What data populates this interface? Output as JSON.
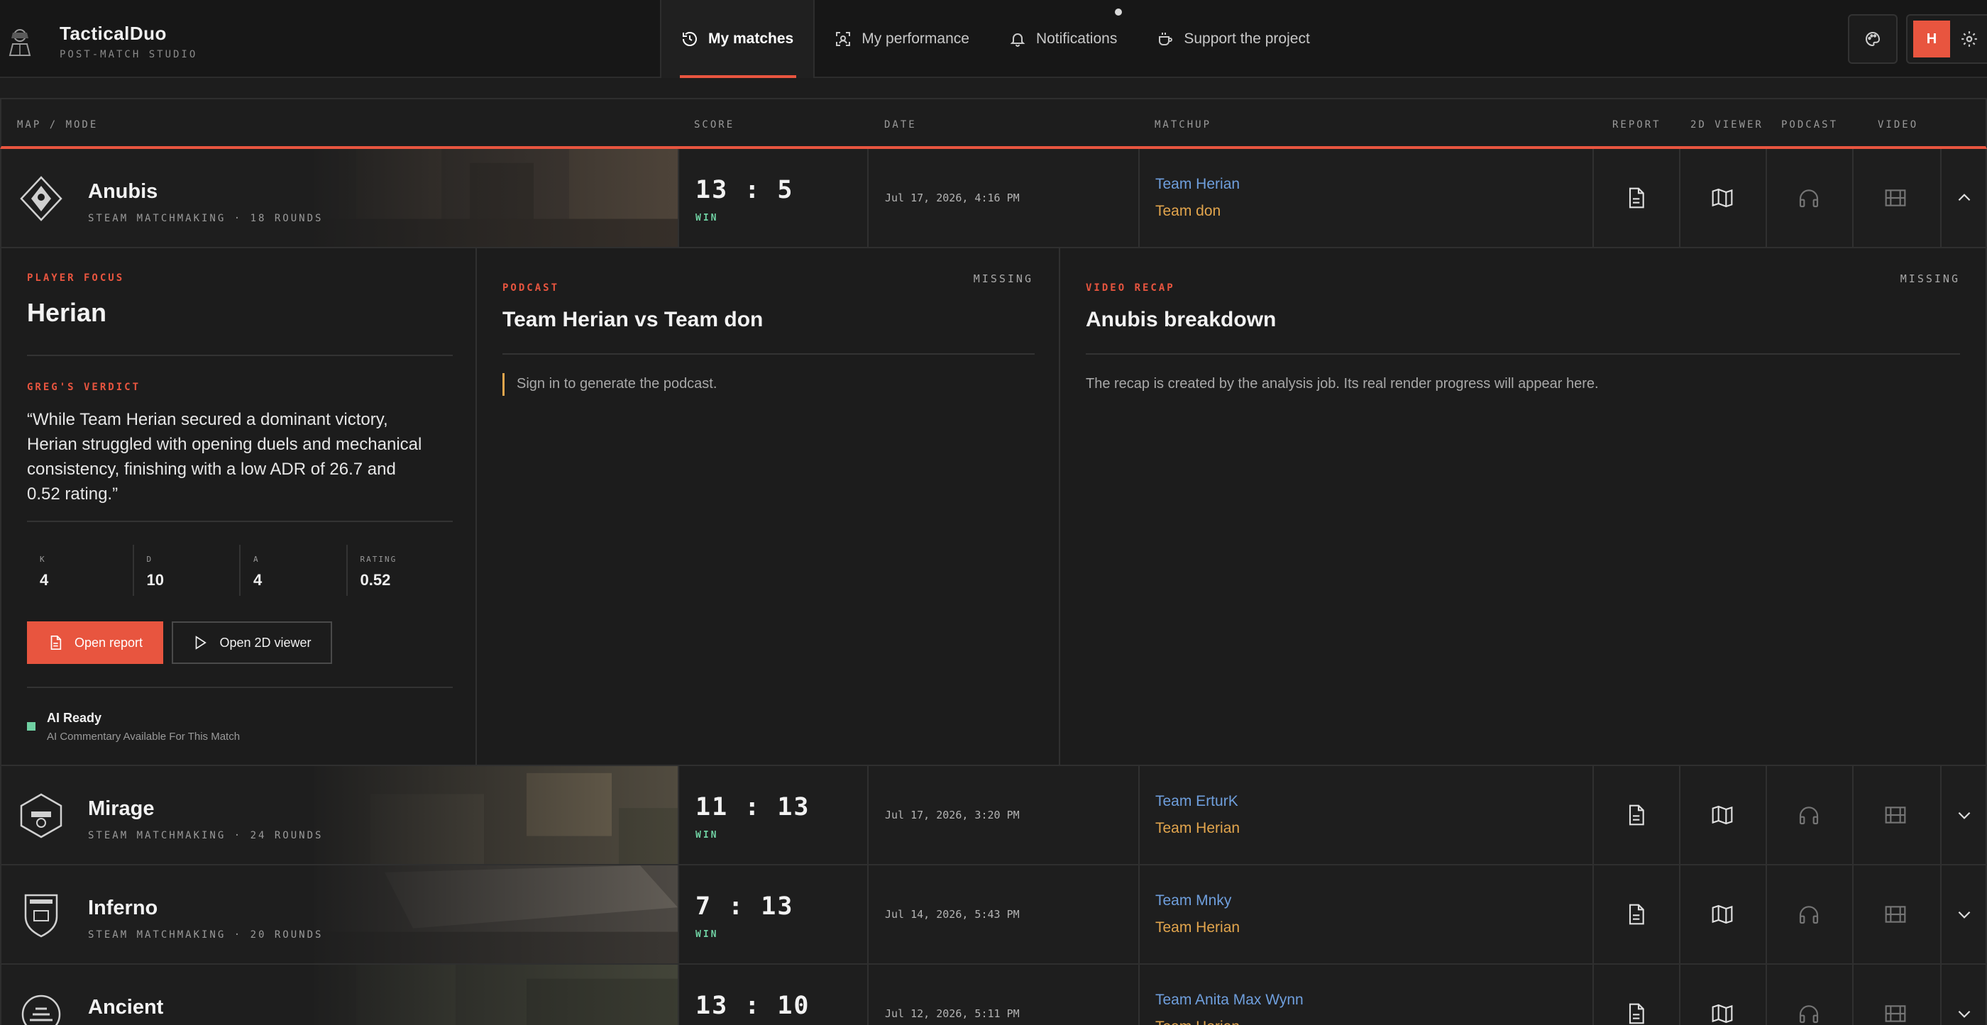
{
  "app": {
    "name": "TacticalDuo",
    "subtitle": "POST-MATCH STUDIO"
  },
  "nav": {
    "items": [
      {
        "label": "My matches",
        "icon": "history-icon",
        "active": true
      },
      {
        "label": "My performance",
        "icon": "target-icon",
        "active": false
      },
      {
        "label": "Notifications",
        "icon": "bell-icon",
        "active": false
      },
      {
        "label": "Support the project",
        "icon": "coffee-icon",
        "active": false
      }
    ]
  },
  "user": {
    "initial": "H"
  },
  "table": {
    "headers": {
      "map": "MAP / MODE",
      "score": "SCORE",
      "date": "DATE",
      "matchup": "MATCHUP",
      "report": "REPORT",
      "viewer": "2D VIEWER",
      "podcast": "PODCAST",
      "video": "VIDEO"
    },
    "rows": [
      {
        "map": "Anubis",
        "mode": "STEAM MATCHMAKING · 18 ROUNDS",
        "score": "13 : 5",
        "result": "WIN",
        "date": "Jul 17, 2026, 4:16 PM",
        "team_a": "Team Herian",
        "team_b": "Team don",
        "expanded": true
      },
      {
        "map": "Mirage",
        "mode": "STEAM MATCHMAKING · 24 ROUNDS",
        "score": "11 : 13",
        "result": "WIN",
        "date": "Jul 17, 2026, 3:20 PM",
        "team_a": "Team ErturK",
        "team_b": "Team Herian",
        "expanded": false
      },
      {
        "map": "Inferno",
        "mode": "STEAM MATCHMAKING · 20 ROUNDS",
        "score": "7 : 13",
        "result": "WIN",
        "date": "Jul 14, 2026, 5:43 PM",
        "team_a": "Team Mnky",
        "team_b": "Team Herian",
        "expanded": false
      },
      {
        "map": "Ancient",
        "mode": "",
        "score": "13 : 10",
        "result": "",
        "date": "Jul 12, 2026, 5:11 PM",
        "team_a": "Team Anita Max Wynn",
        "team_b": "Team Herian",
        "expanded": false
      }
    ]
  },
  "detail": {
    "focus_label": "PLAYER FOCUS",
    "player": "Herian",
    "verdict_label": "GREG'S VERDICT",
    "verdict": "“While Team Herian secured a dominant victory, Herian struggled with opening duels and mechanical consistency, finishing with a low ADR of 26.7 and 0.52 rating.”",
    "stats": [
      {
        "label": "K",
        "value": "4"
      },
      {
        "label": "D",
        "value": "10"
      },
      {
        "label": "A",
        "value": "4"
      },
      {
        "label": "RATING",
        "value": "0.52"
      }
    ],
    "open_report": "Open report",
    "open_viewer": "Open 2D viewer",
    "ai_title": "AI Ready",
    "ai_sub": "AI Commentary Available For This Match",
    "podcast": {
      "label": "PODCAST",
      "status": "MISSING",
      "title": "Team Herian vs Team don",
      "note": "Sign in to generate the podcast."
    },
    "video": {
      "label": "VIDEO RECAP",
      "status": "MISSING",
      "title": "Anubis breakdown",
      "note": "The recap is created by the analysis job. Its real render progress will appear here."
    }
  },
  "colors": {
    "accent": "#e8553f",
    "win": "#6fd0a2",
    "team_a": "#6f9fdd",
    "team_b": "#e2a54d"
  }
}
